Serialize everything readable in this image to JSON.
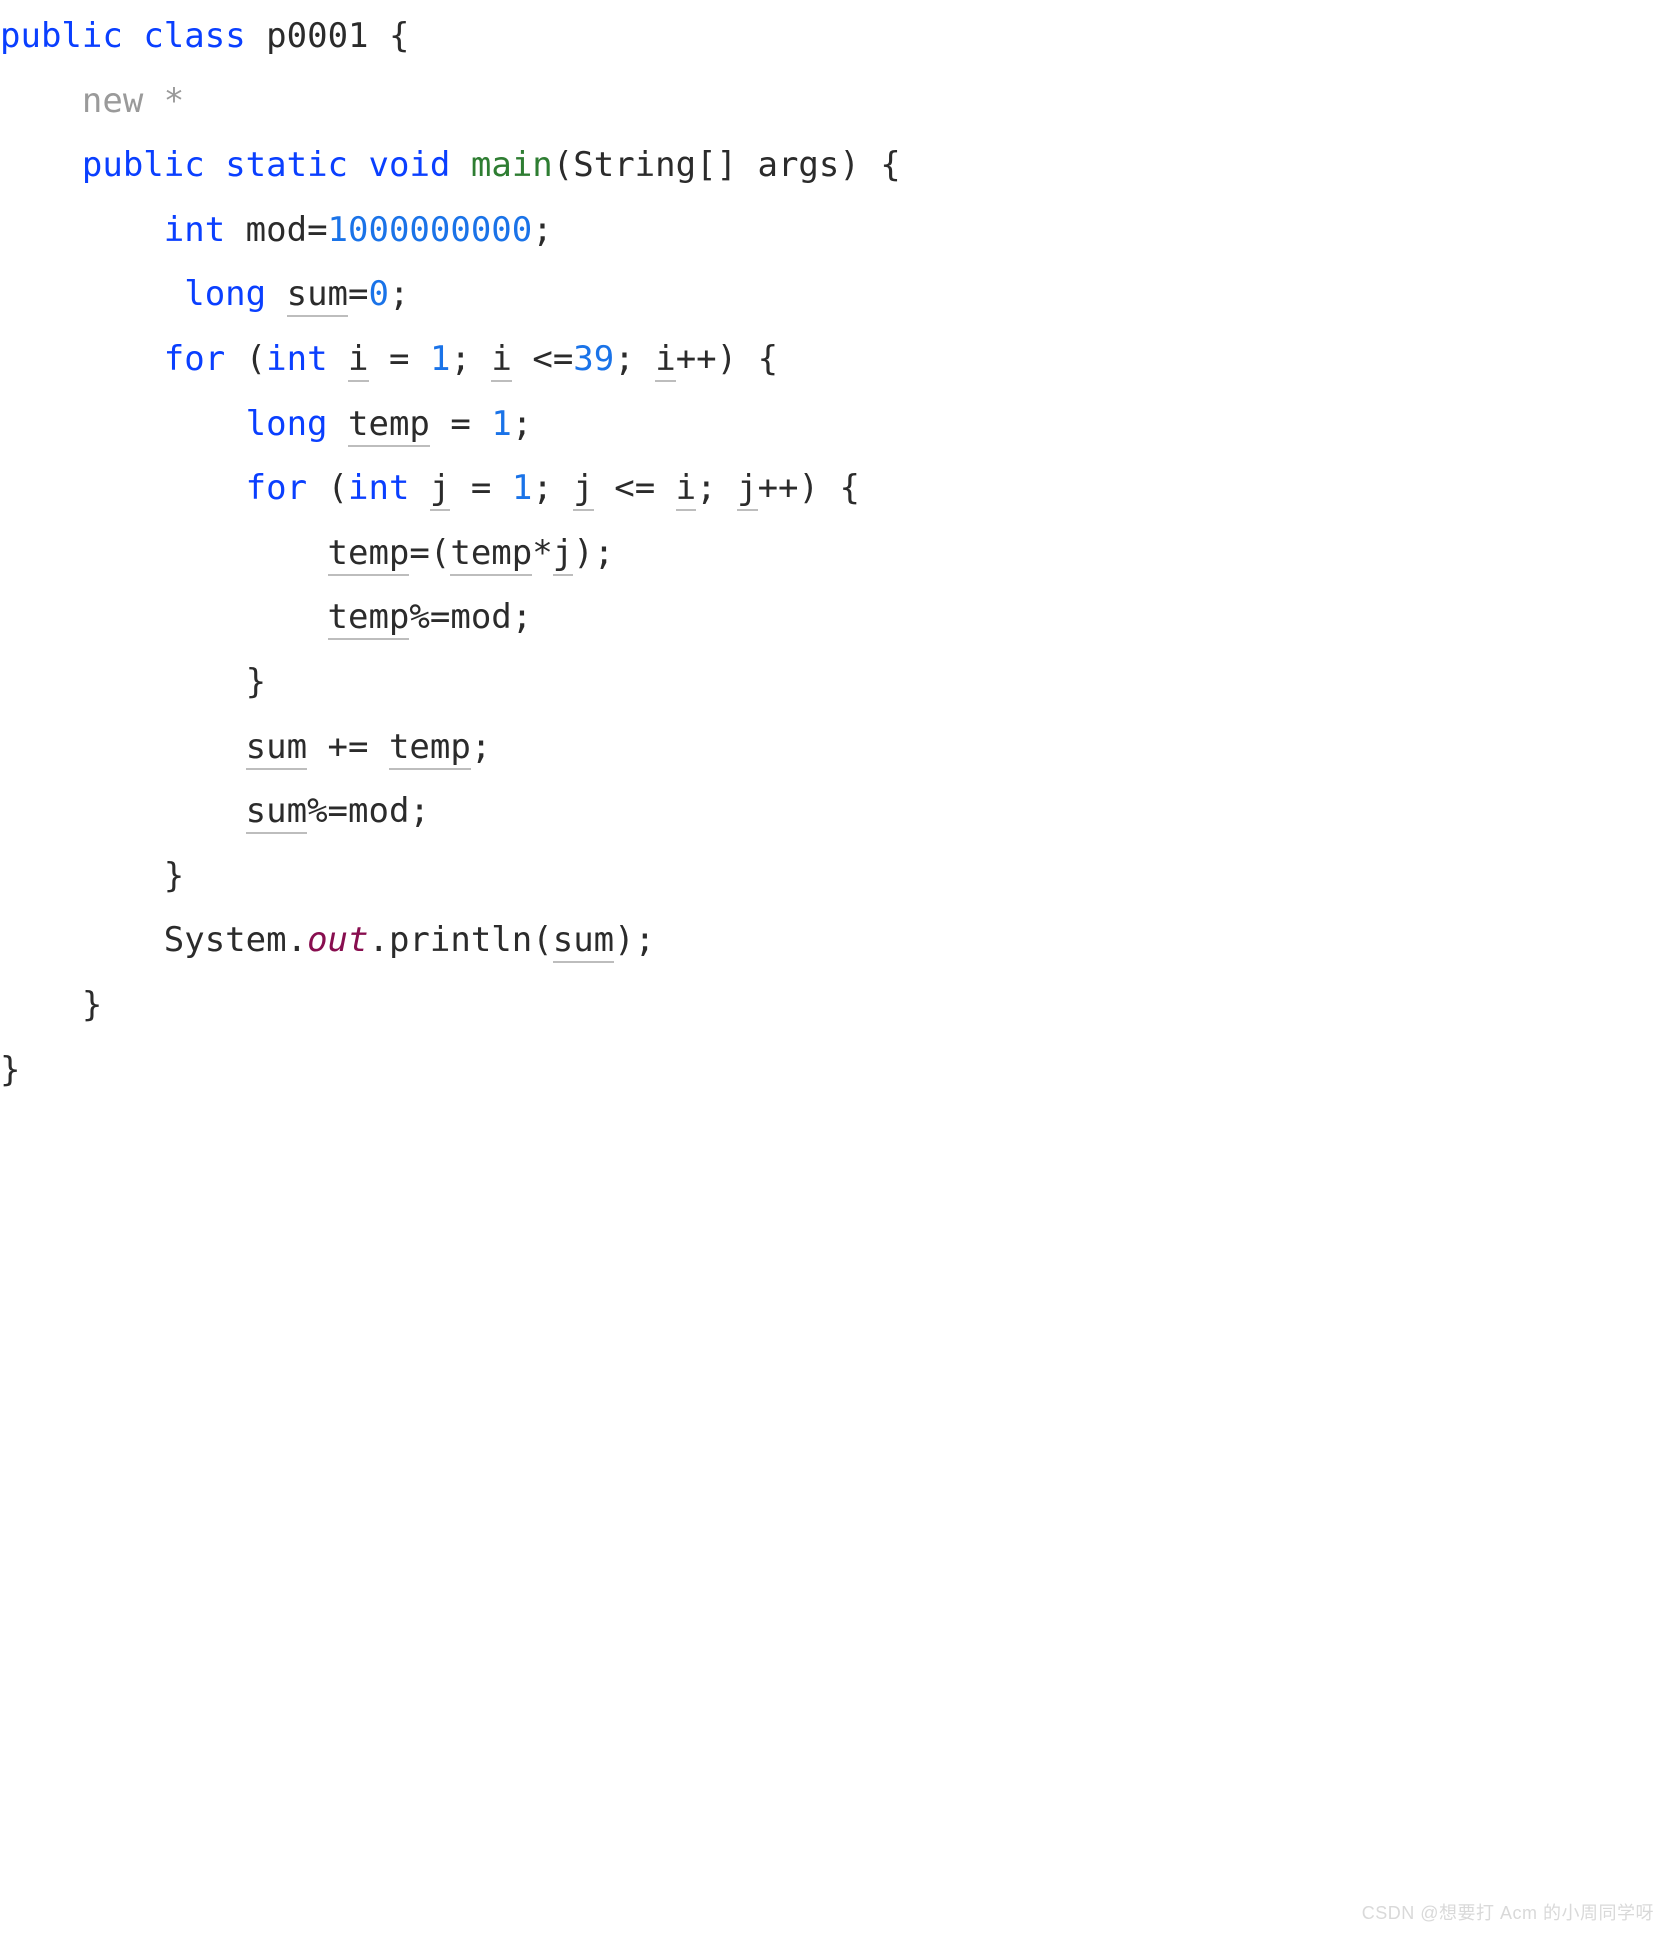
{
  "code": {
    "decl_public": "public",
    "decl_class": "class",
    "class_name": "p0001",
    "brace_open": "{",
    "brace_close": "}",
    "hint_new": "new *",
    "kw_static": "static",
    "kw_void": "void",
    "fn_main": "main",
    "main_params_open": "(String[] args) ",
    "kw_int": "int",
    "stmt_mod_lhs": " mod=",
    "num_mod": "1000000000",
    "semi": ";",
    "kw_long": "long",
    "var_sum": "sum",
    "eq": "=",
    "num_zero": "0",
    "kw_for": "for",
    "paren_open": " (",
    "var_i": "i",
    "assign_sp": " = ",
    "num_one": "1",
    "semi_sp": "; ",
    "lte": " <=",
    "num_39": "39",
    "inc": "++",
    "paren_close_sp": ") ",
    "var_temp": "temp",
    "var_j": "j",
    "lte_sp": " <= ",
    "stmt_temp_assign_open": "=(",
    "op_mul": "*",
    "close_paren_semi": ");",
    "op_mod_eq": "%=",
    "txt_mod": "mod;",
    "op_plus_eq": " += ",
    "sys": "System.",
    "out": "out",
    "println_open": ".println(",
    "close_semi": ");"
  },
  "watermark": "CSDN @想要打 Acm 的小周同学呀"
}
